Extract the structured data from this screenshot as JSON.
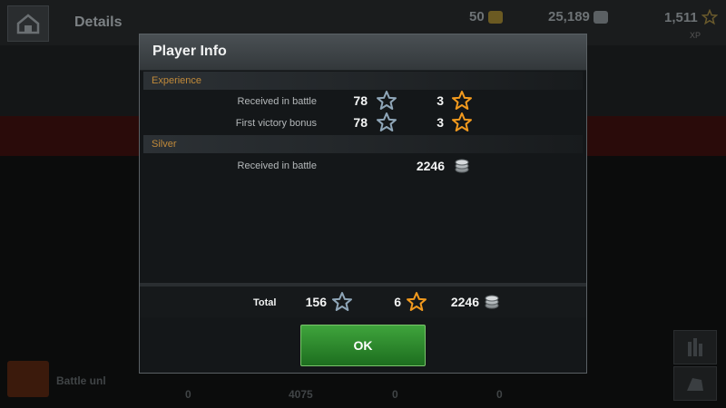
{
  "background": {
    "title": "Details",
    "gold": "50",
    "silver": "25,189",
    "xp": "1,511",
    "xp_label": "XP",
    "battle_text": "Battle unl",
    "bottom_values": [
      "0",
      "4075",
      "0",
      "0"
    ]
  },
  "dialog": {
    "title": "Player Info",
    "experience_header": "Experience",
    "silver_header": "Silver",
    "rows": [
      {
        "label": "Received in battle",
        "xp": "78",
        "free_xp": "3"
      },
      {
        "label": "First victory bonus",
        "xp": "78",
        "free_xp": "3"
      }
    ],
    "silver_rows": [
      {
        "label": "Received in battle",
        "value": "2246"
      }
    ],
    "total": {
      "label": "Total",
      "xp": "156",
      "free_xp": "6",
      "silver": "2246"
    },
    "ok_label": "OK"
  },
  "colors": {
    "accent_orange": "#f29a1e",
    "star_blue": "#8fa6b8",
    "section_text": "#c18a3a",
    "ok_green": "#2f8a2d"
  },
  "icons": [
    "home-icon",
    "gold-coin-icon",
    "silver-coin-icon",
    "xp-star-icon",
    "free-xp-star-icon",
    "stats-icon",
    "tank-icon"
  ]
}
